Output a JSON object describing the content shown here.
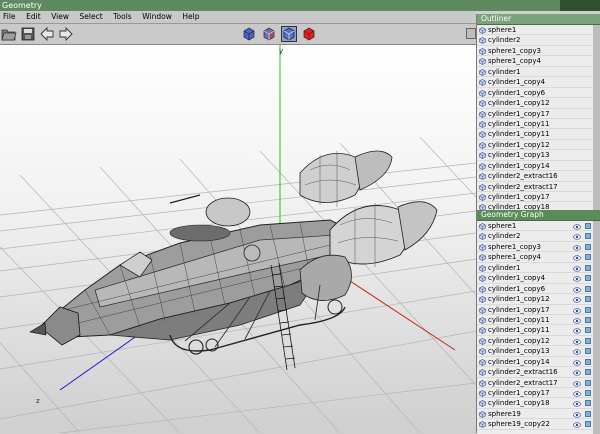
{
  "window": {
    "title": "Geometry"
  },
  "menu": [
    "File",
    "Edit",
    "View",
    "Select",
    "Tools",
    "Window",
    "Help"
  ],
  "toolbar": {
    "left_icons": [
      "folder-open-icon",
      "save-icon",
      "arrow-left-icon",
      "arrow-right-icon"
    ],
    "view_icons": [
      "cube-view-blue-icon",
      "cube-view-wire-icon",
      "cube-view-selected-icon",
      "cube-view-red-icon"
    ],
    "colors": {
      "red_cube": "#e0201c",
      "blue_cube": "#3e5cc8"
    }
  },
  "viewport": {
    "axis_labels": {
      "y": "y",
      "z": "z"
    },
    "axis_colors": {
      "x": "#d02020",
      "y": "#20c020",
      "z": "#2020d0"
    }
  },
  "outliner": {
    "title": "Outliner",
    "items": [
      "sphere1",
      "cylinder2",
      "sphere1_copy3",
      "sphere1_copy4",
      "cylinder1",
      "cylinder1_copy4",
      "cylinder1_copy6",
      "cylinder1_copy12",
      "cylinder1_copy17",
      "cylinder1_copy11",
      "cylinder1_copy11",
      "cylinder1_copy12",
      "cylinder1_copy13",
      "cylinder1_copy14",
      "cylinder2_extract16",
      "cylinder2_extract17",
      "cylinder1_copy17",
      "cylinder1_copy18"
    ]
  },
  "geometry_graph": {
    "title": "Geometry Graph",
    "items": [
      "sphere1",
      "cylinder2",
      "sphere1_copy3",
      "sphere1_copy4",
      "cylinder1",
      "cylinder1_copy4",
      "cylinder1_copy6",
      "cylinder1_copy12",
      "cylinder1_copy17",
      "cylinder1_copy11",
      "cylinder1_copy11",
      "cylinder1_copy12",
      "cylinder1_copy13",
      "cylinder1_copy14",
      "cylinder2_extract16",
      "cylinder2_extract17",
      "cylinder1_copy17",
      "cylinder1_copy18",
      "sphere19",
      "sphere19_copy22"
    ]
  }
}
